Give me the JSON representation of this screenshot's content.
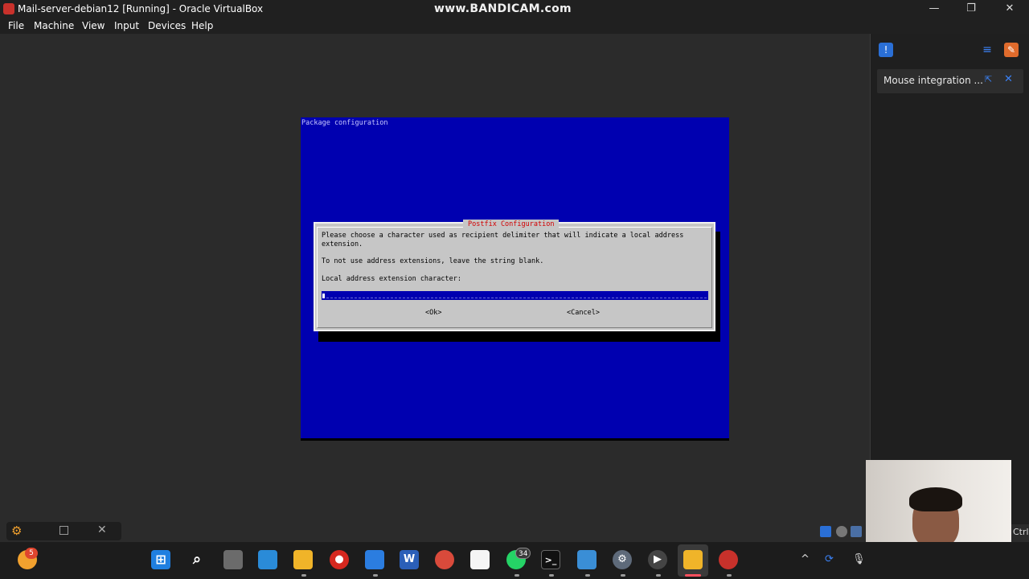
{
  "window": {
    "title": "Mail-server-debian12 [Running] - Oracle VirtualBox",
    "watermark": "www.BANDICAM.com",
    "minimize": "—",
    "restore": "❐",
    "close": "✕"
  },
  "menu": {
    "file": "File",
    "machine": "Machine",
    "view": "View",
    "input": "Input",
    "devices": "Devices",
    "help": "Help"
  },
  "guest": {
    "backtitle": "Package configuration",
    "dialog": {
      "title": "Postfix Configuration",
      "line1": "Please choose a character used as recipient delimiter that will indicate a local address",
      "line2": "extension.",
      "line3": "To not use address extensions, leave the string blank.",
      "prompt": "Local address extension character:",
      "input_value": "",
      "ok_label": "<Ok>",
      "cancel_label": "<Cancel>"
    }
  },
  "notifications": {
    "mouse_integration": "Mouse integration ...",
    "pin_glyph": "⇱",
    "close_glyph": "✕"
  },
  "statusbar": {
    "host_key": "Ctrl",
    "widget_close": "✕"
  },
  "taskbar": {
    "weather_badge": "5",
    "whatsapp_badge": "34",
    "tray_chevron": "^"
  },
  "colors": {
    "guest_blue": "#0000b0",
    "dialog_gray": "#c6c6c6",
    "dialog_title_red": "#d20000",
    "accent_blue": "#3b82f6"
  }
}
